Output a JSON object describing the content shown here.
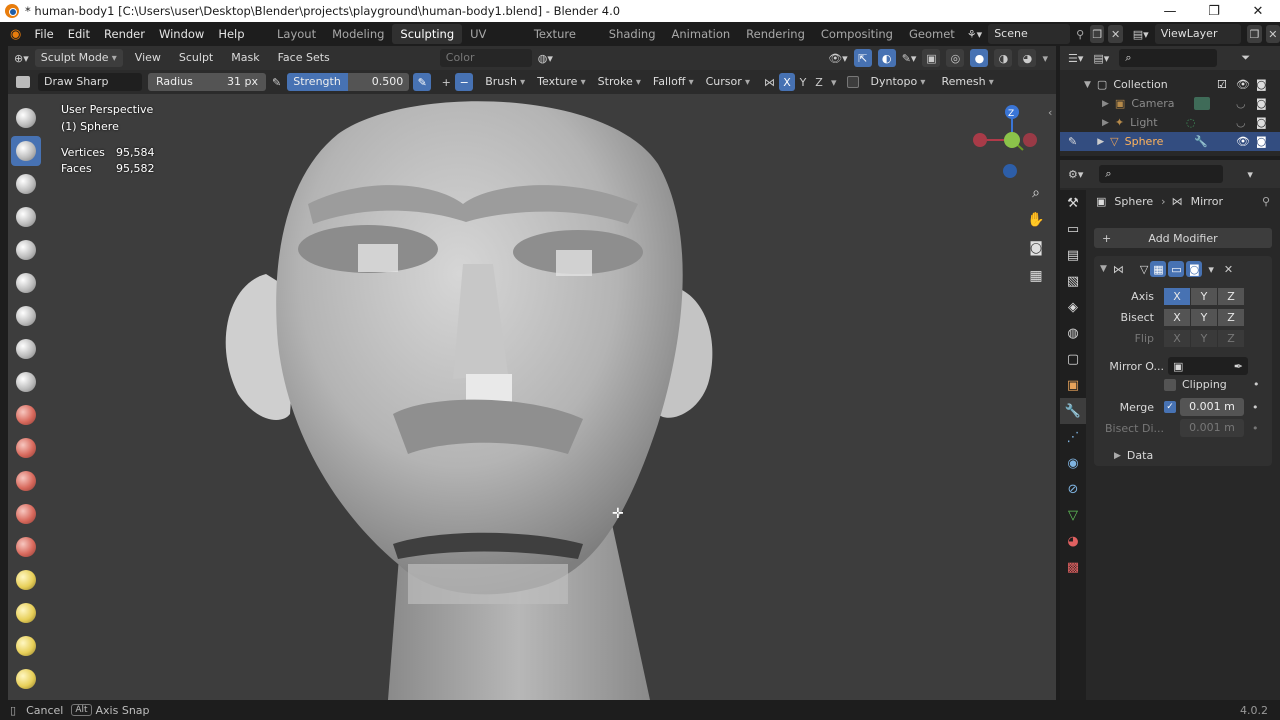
{
  "window": {
    "title": "* human-body1 [C:\\Users\\user\\Desktop\\Blender\\projects\\playground\\human-body1.blend] - Blender 4.0",
    "minimize": "—",
    "maximize": "❐",
    "close": "✕"
  },
  "menu": [
    "File",
    "Edit",
    "Render",
    "Window",
    "Help"
  ],
  "workspaces": [
    "Layout",
    "Modeling",
    "Sculpting",
    "UV Editing",
    "Texture Paint",
    "Shading",
    "Animation",
    "Rendering",
    "Compositing",
    "Geomet"
  ],
  "active_workspace": "Sculpting",
  "scene": "Scene",
  "view_layer": "ViewLayer",
  "viewport_header": {
    "mode": "Sculpt Mode",
    "menus": [
      "View",
      "Sculpt",
      "Mask",
      "Face Sets"
    ],
    "color_attribute": "Color Attribut..."
  },
  "tool_header": {
    "brush_name": "Draw Sharp",
    "radius_label": "Radius",
    "radius_value": "31 px",
    "strength_label": "Strength",
    "strength_value": "0.500",
    "plus": "+",
    "minus": "−",
    "dropdowns": [
      "Brush",
      "Texture",
      "Stroke",
      "Falloff",
      "Cursor"
    ],
    "axes": [
      "X",
      "Y",
      "Z"
    ],
    "dyntopo": "Dyntopo",
    "remesh": "Remesh"
  },
  "viewport": {
    "perspective": "User Perspective",
    "object": "(1) Sphere",
    "stats": [
      {
        "label": "Vertices",
        "value": "95,584"
      },
      {
        "label": "Faces",
        "value": "95,582"
      }
    ],
    "gizmo": {
      "z": "Z"
    }
  },
  "outliner": {
    "items": [
      {
        "name": "Collection",
        "icon": "collection-icon"
      },
      {
        "name": "Camera",
        "icon": "camera-icon"
      },
      {
        "name": "Light",
        "icon": "light-icon"
      },
      {
        "name": "Sphere",
        "icon": "mesh-icon"
      }
    ]
  },
  "properties": {
    "breadcrumb_object": "Sphere",
    "breadcrumb_modifier": "Mirror",
    "add_modifier": "Add Modifier",
    "axis_label": "Axis",
    "bisect_label": "Bisect",
    "flip_label": "Flip",
    "axes": [
      "X",
      "Y",
      "Z"
    ],
    "mirror_object_label": "Mirror O...",
    "clipping_label": "Clipping",
    "merge_label": "Merge",
    "merge_value": "0.001 m",
    "bisect_distance_label": "Bisect Di...",
    "bisect_distance_value": "0.001 m",
    "data_label": "Data"
  },
  "status": {
    "cancel": "Cancel",
    "alt_key": "Alt",
    "axis_snap": "Axis Snap",
    "version": "4.0.2"
  },
  "colors": {
    "accent": "#4772b3",
    "selected_row": "#334d80",
    "viewport_bg": "#3d3d3d",
    "panel_bg": "#282828"
  }
}
